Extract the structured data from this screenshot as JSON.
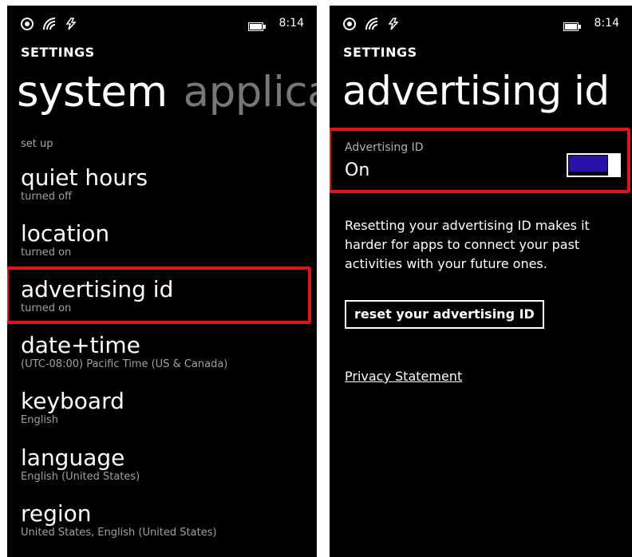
{
  "status_bar": {
    "time": "8:14",
    "icons": [
      "nfc-icon",
      "signal-icon",
      "data-icon",
      "battery-icon"
    ]
  },
  "left": {
    "header": "SETTINGS",
    "pivot_active": "system",
    "pivot_next": "applicat",
    "section_label": "set up",
    "items": [
      {
        "title": "quiet hours",
        "subtitle": "turned off"
      },
      {
        "title": "location",
        "subtitle": "turned on"
      },
      {
        "title": "advertising id",
        "subtitle": "turned on"
      },
      {
        "title": "date+time",
        "subtitle": "(UTC-08:00) Pacific Time (US & Canada)"
      },
      {
        "title": "keyboard",
        "subtitle": "English"
      },
      {
        "title": "language",
        "subtitle": "English (United States)"
      },
      {
        "title": "region",
        "subtitle": "United States, English (United States)"
      }
    ]
  },
  "right": {
    "header": "SETTINGS",
    "page_title": "advertising id",
    "toggle": {
      "label": "Advertising ID",
      "value": "On",
      "state": "on"
    },
    "description": "Resetting your advertising ID makes it harder for apps to connect your past activities with your future ones.",
    "reset_button": "reset your advertising ID",
    "privacy_link": "Privacy Statement"
  },
  "colors": {
    "highlight": "#e0141b",
    "toggle_on": "#2a0ea8",
    "background": "#000000"
  }
}
